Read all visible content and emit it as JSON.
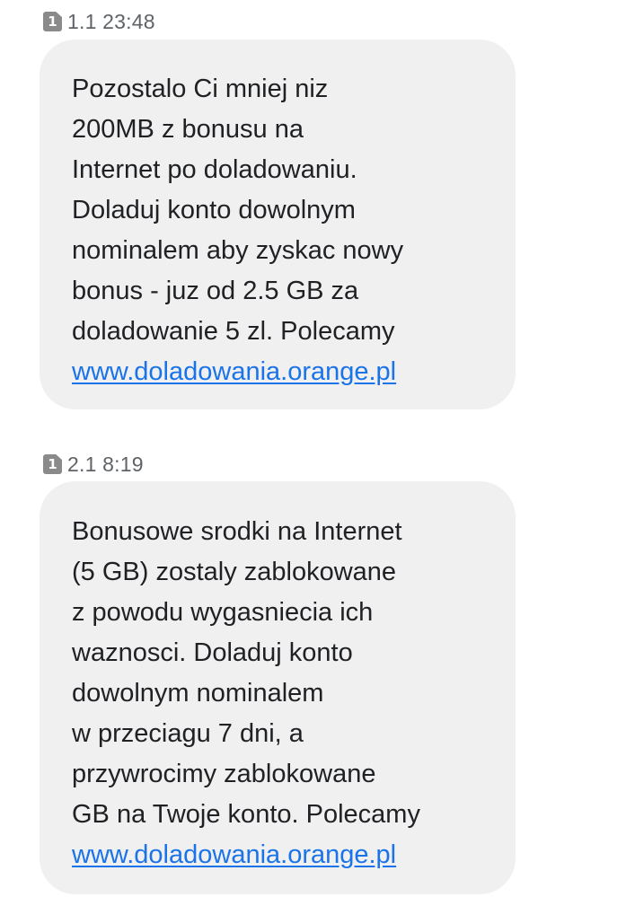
{
  "messages": [
    {
      "sim_badge": "1",
      "timestamp": "1.1 23:48",
      "lines": [
        "Pozostalo Ci mniej niz",
        "200MB z bonusu na",
        "Internet po doladowaniu.",
        "Doladuj konto dowolnym",
        "nominalem aby zyskac nowy",
        "bonus - juz od 2.5 GB za",
        "doladowanie 5 zl. Polecamy"
      ],
      "link": "www.doladowania.orange.pl"
    },
    {
      "sim_badge": "1",
      "timestamp": "2.1 8:19",
      "lines": [
        "Bonusowe srodki na Internet",
        "(5 GB) zostaly zablokowane",
        "z powodu wygasniecia ich",
        "waznosci. Doladuj konto",
        "dowolnym nominalem",
        "w przeciagu 7 dni, a",
        "przywrocimy zablokowane",
        "GB na Twoje konto. Polecamy"
      ],
      "link": "www.doladowania.orange.pl"
    }
  ],
  "colors": {
    "bubble_background": "#f0f0f0",
    "link": "#1a73e8",
    "sim_badge": "#8a8a8a",
    "timestamp": "#5f6368"
  }
}
